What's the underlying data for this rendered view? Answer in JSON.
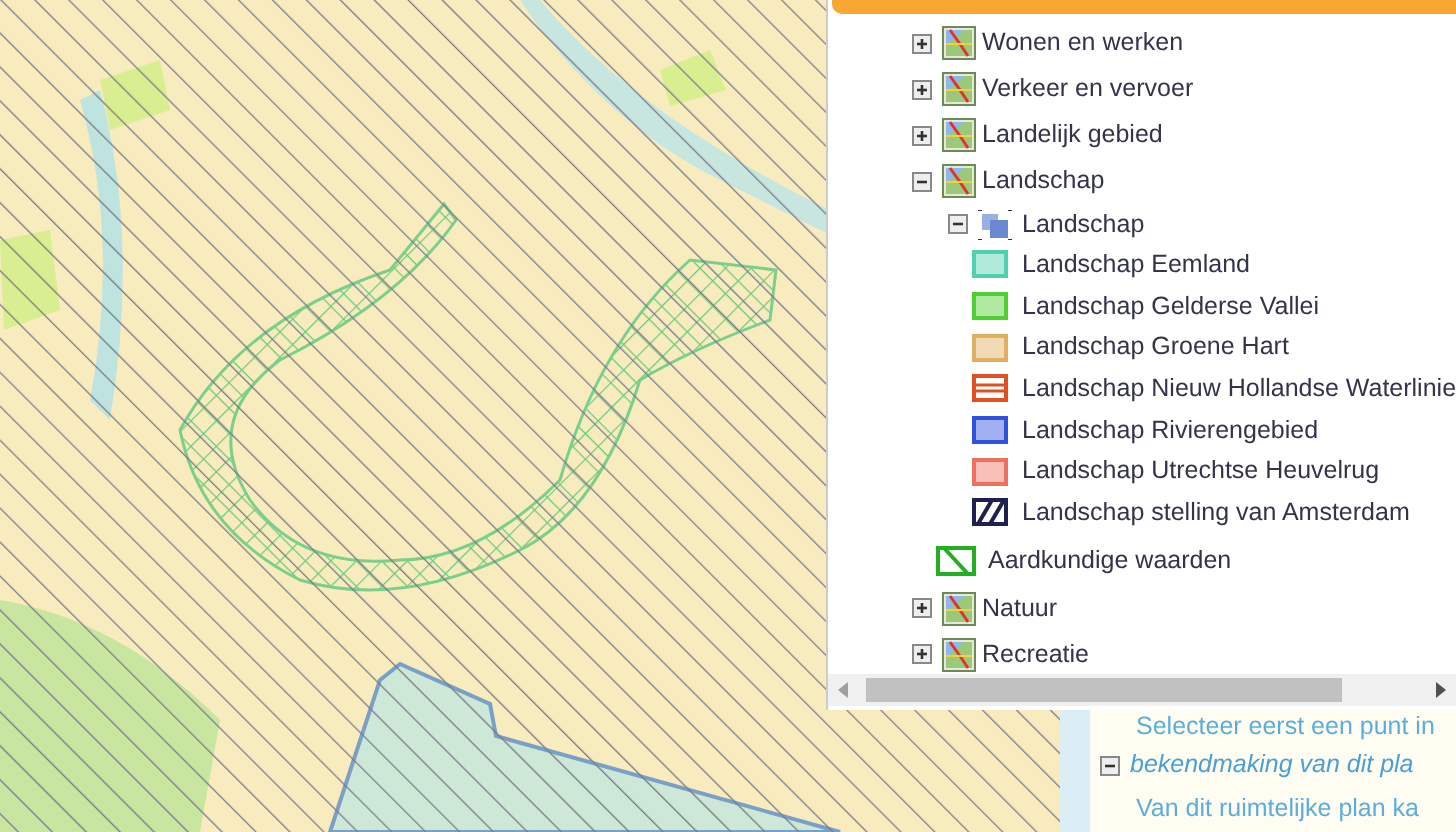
{
  "layers": [
    {
      "label": "Wonen en werken",
      "expanded": false
    },
    {
      "label": "Verkeer en vervoer",
      "expanded": false
    },
    {
      "label": "Landelijk gebied",
      "expanded": false
    },
    {
      "label": "Landschap",
      "expanded": true,
      "children": [
        {
          "label": "Landschap",
          "kind": "group",
          "expanded": true,
          "children": [
            {
              "label": "Landschap Eemland",
              "kind": "fill",
              "color": "#50d0b0"
            },
            {
              "label": "Landschap Gelderse Vallei",
              "kind": "fill",
              "color": "#50d030"
            },
            {
              "label": "Landschap Groene Hart",
              "kind": "fill",
              "color": "#e0b060"
            },
            {
              "label": "Landschap Nieuw Hollandse Waterlinie",
              "kind": "stripes",
              "color": "#e05020"
            },
            {
              "label": "Landschap Rivierengebied",
              "kind": "fill",
              "color": "#3050e0"
            },
            {
              "label": "Landschap Utrechtse Heuvelrug",
              "kind": "fill",
              "color": "#f07060"
            },
            {
              "label": "Landschap stelling van Amsterdam",
              "kind": "hatch",
              "color": "#202050"
            }
          ]
        },
        {
          "label": "Aardkundige waarden",
          "kind": "hatch-wide",
          "color": "#20b020"
        }
      ]
    },
    {
      "label": "Natuur",
      "expanded": false
    },
    {
      "label": "Recreatie",
      "expanded": false
    }
  ],
  "info_panel": {
    "hint": "Selecteer eerst een punt in",
    "section": {
      "title": "bekendmaking van dit pla",
      "expanded": true,
      "text": "Van dit ruimtelijke plan ka"
    }
  }
}
